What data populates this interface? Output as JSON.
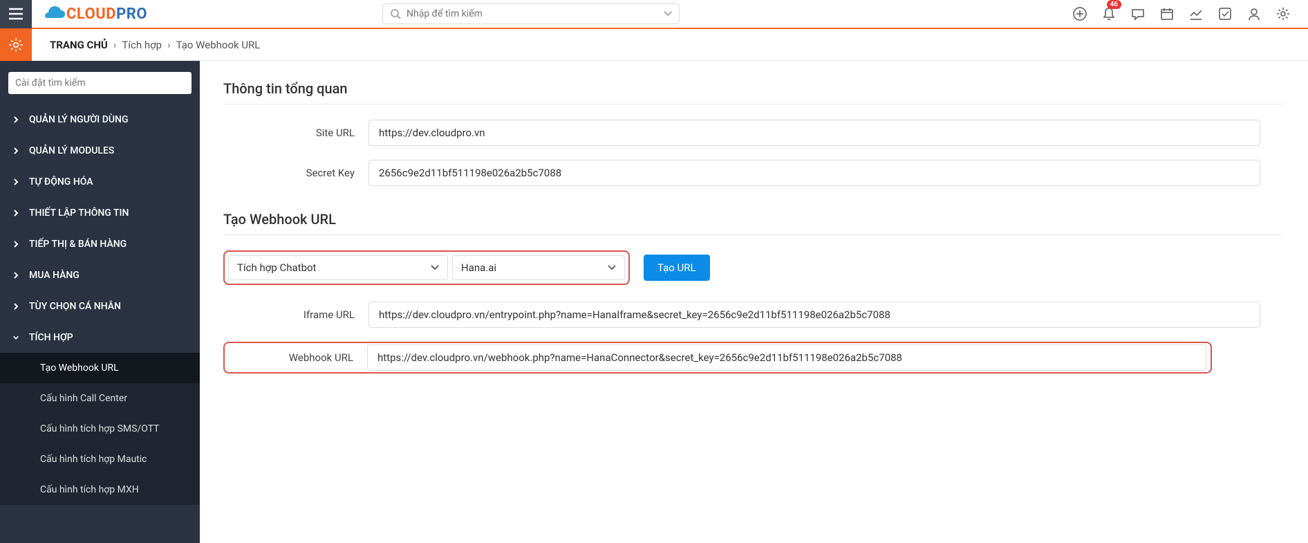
{
  "header": {
    "search_placeholder": "Nhập để tìm kiếm",
    "notification_count": "46"
  },
  "logo": {
    "part1": "CLOUD",
    "part2": "PRO"
  },
  "breadcrumb": {
    "home": "TRANG CHỦ",
    "items": [
      "Tích hợp",
      "Tạo Webhook URL"
    ]
  },
  "sidebar": {
    "search_placeholder": "Cài đặt tìm kiếm",
    "items": [
      "QUẢN LÝ NGƯỜI DÙNG",
      "QUẢN LÝ MODULES",
      "TỰ ĐỘNG HÓA",
      "THIẾT LẬP THÔNG TIN",
      "TIẾP THỊ & BÁN HÀNG",
      "MUA HÀNG",
      "TÙY CHỌN CÁ NHÂN",
      "TÍCH HỢP"
    ],
    "subitems": [
      "Tạo Webhook URL",
      "Cấu hình Call Center",
      "Cấu hình tích hợp SMS/OTT",
      "Cấu hình tích hợp Mautic",
      "Cấu hình tích hợp MXH"
    ]
  },
  "overview": {
    "title": "Thông tin tổng quan",
    "site_url_label": "Site URL",
    "site_url_value": "https://dev.cloudpro.vn",
    "secret_key_label": "Secret Key",
    "secret_key_value": "2656c9e2d11bf511198e026a2b5c7088"
  },
  "webhook": {
    "title": "Tạo Webhook URL",
    "select1": "Tích hợp Chatbot",
    "select2": "Hana.ai",
    "create_btn": "Tạo URL",
    "iframe_label": "Iframe URL",
    "iframe_value": "https://dev.cloudpro.vn/entrypoint.php?name=HanaIframe&secret_key=2656c9e2d11bf511198e026a2b5c7088",
    "webhook_label": "Webhook URL",
    "webhook_value": "https://dev.cloudpro.vn/webhook.php?name=HanaConnector&secret_key=2656c9e2d11bf511198e026a2b5c7088"
  }
}
